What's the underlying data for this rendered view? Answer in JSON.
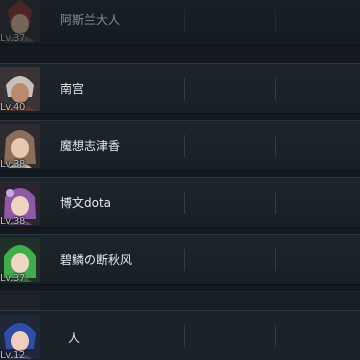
{
  "friends": [
    {
      "name": "阿斯兰大人",
      "level": "Lv.37",
      "dim": true
    },
    {
      "name": "南宫",
      "level": "Lv.40",
      "dim": false
    },
    {
      "name": "魔想志津香",
      "level": "Lv.38",
      "dim": false
    },
    {
      "name": "博文dota",
      "level": "Lv.38",
      "dim": false
    },
    {
      "name": "碧鳞の断秋风",
      "level": "Lv.37",
      "dim": false
    },
    {
      "name": "",
      "level": "",
      "dim": true
    }
  ],
  "self": {
    "name": "人",
    "level": "Lv.12"
  },
  "colors": {
    "background": "#13191e",
    "row": "#1b232a",
    "text": "#e6eaee"
  }
}
